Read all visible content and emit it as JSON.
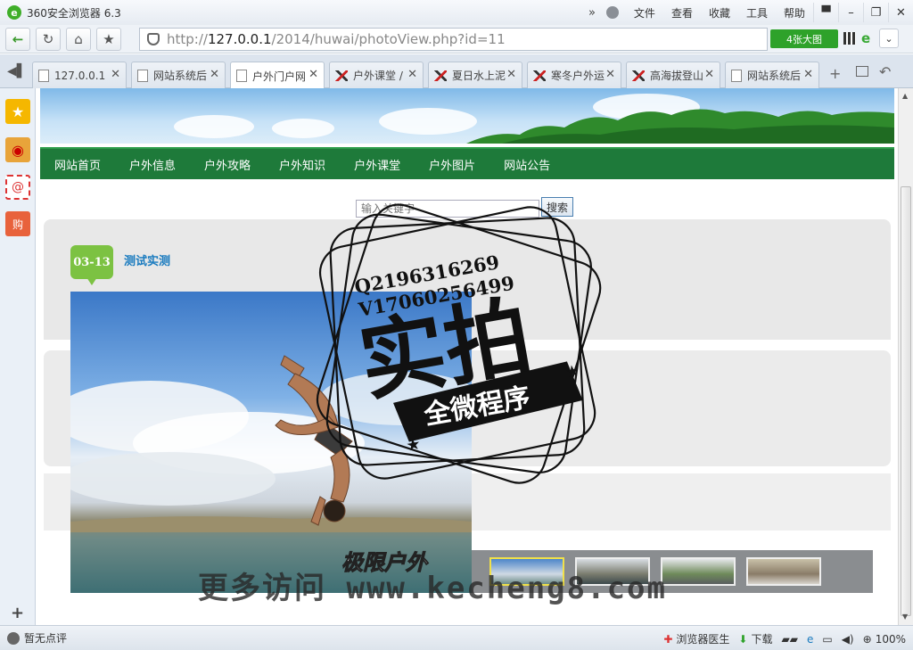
{
  "window": {
    "title": "360安全浏览器 6.3",
    "menu": [
      "文件",
      "查看",
      "收藏",
      "工具",
      "帮助"
    ],
    "chevrons": "»",
    "controls": {
      "skin": "▀",
      "minimize": "–",
      "restore": "❐",
      "close": "✕"
    }
  },
  "navbar": {
    "url_prefix": "http://",
    "url_host": "127.0.0.1",
    "url_path": "/2014/huwai/photoView.php?id=11",
    "big_pic_label": "4张大图",
    "ie_label": "e",
    "dropdown_label": "⌄"
  },
  "tabs": [
    {
      "label": "127.0.0.1",
      "icon": "page"
    },
    {
      "label": "网站系统后",
      "icon": "page"
    },
    {
      "label": "户外门户网",
      "icon": "page",
      "active": true
    },
    {
      "label": "户外课堂 /",
      "icon": "pic"
    },
    {
      "label": "夏日水上泥",
      "icon": "pic"
    },
    {
      "label": "寒冬户外运",
      "icon": "pic"
    },
    {
      "label": "高海拔登山",
      "icon": "pic"
    },
    {
      "label": "网站系统后",
      "icon": "page"
    }
  ],
  "tab_close": "✕",
  "site": {
    "nav": [
      "网站首页",
      "户外信息",
      "户外攻略",
      "户外知识",
      "户外课堂",
      "户外图片",
      "网站公告"
    ],
    "search_placeholder": "输入关键字",
    "search_button": "搜索",
    "post_date": "03-13",
    "post_title": "测试实测",
    "brand_text": "极限户外"
  },
  "watermark": {
    "qq": "Q2196316269",
    "vx": "V17060256499",
    "big": "实拍",
    "ribbon": "全微程序",
    "footer": "更多访问 www.kecheng8.com"
  },
  "statusbar": {
    "left_text": "暂无点评",
    "items": [
      "浏览器医生",
      "下载",
      "100%"
    ]
  },
  "colors": {
    "site_nav": "#1e7a3a",
    "accent_green": "#2ea22a",
    "title_blue": "#1a7bbf",
    "badge_green": "#7cc242"
  }
}
